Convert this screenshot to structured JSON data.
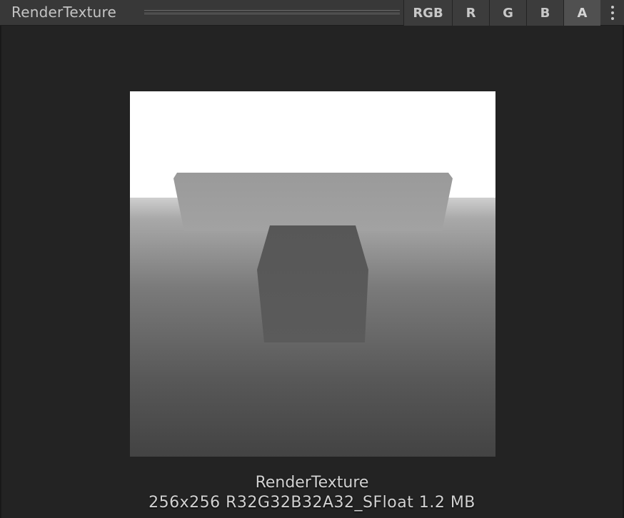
{
  "header": {
    "title": "RenderTexture",
    "channels": [
      {
        "label": "RGB",
        "active": false
      },
      {
        "label": "R",
        "active": false
      },
      {
        "label": "G",
        "active": false
      },
      {
        "label": "B",
        "active": false
      },
      {
        "label": "A",
        "active": true
      }
    ],
    "menu_icon": "kebab-menu-icon"
  },
  "preview": {
    "name": "RenderTexture",
    "details": "256x256  R32G32B32A32_SFloat  1.2 MB",
    "mode": "alpha-channel"
  },
  "colors": {
    "header_bg": "#383838",
    "panel_bg": "#232323",
    "active_button_bg": "#505050"
  }
}
